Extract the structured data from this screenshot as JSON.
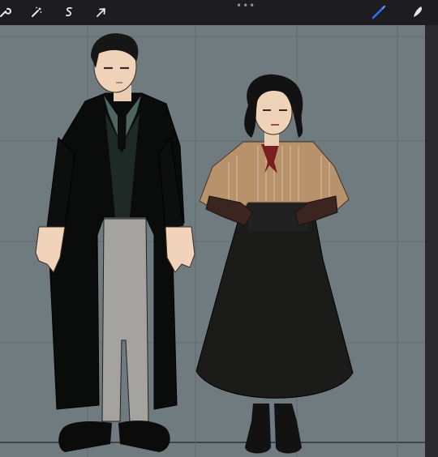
{
  "app": {
    "more_menu_glyph": "•••"
  },
  "toolbar": {
    "left_tools": [
      {
        "icon": "wrench-icon",
        "name": "actions"
      },
      {
        "icon": "magic-wand-icon",
        "name": "adjustments"
      },
      {
        "icon": "selection-s-icon",
        "name": "selection"
      },
      {
        "icon": "arrow-cursor-icon",
        "name": "transform"
      }
    ],
    "right_tools": [
      {
        "icon": "brush-icon",
        "name": "paint",
        "active": true,
        "color": "#2f6bff"
      },
      {
        "icon": "smudge-icon",
        "name": "smudge",
        "active": false
      }
    ]
  },
  "canvas": {
    "background": "#6f7b7f",
    "grid": true,
    "description": "drawing-guide-grid"
  },
  "colors": {
    "accent_blue": "#2f6bff",
    "toolbar_bg": "#1d1d1f",
    "canvas_bg": "#6f7b7f"
  }
}
